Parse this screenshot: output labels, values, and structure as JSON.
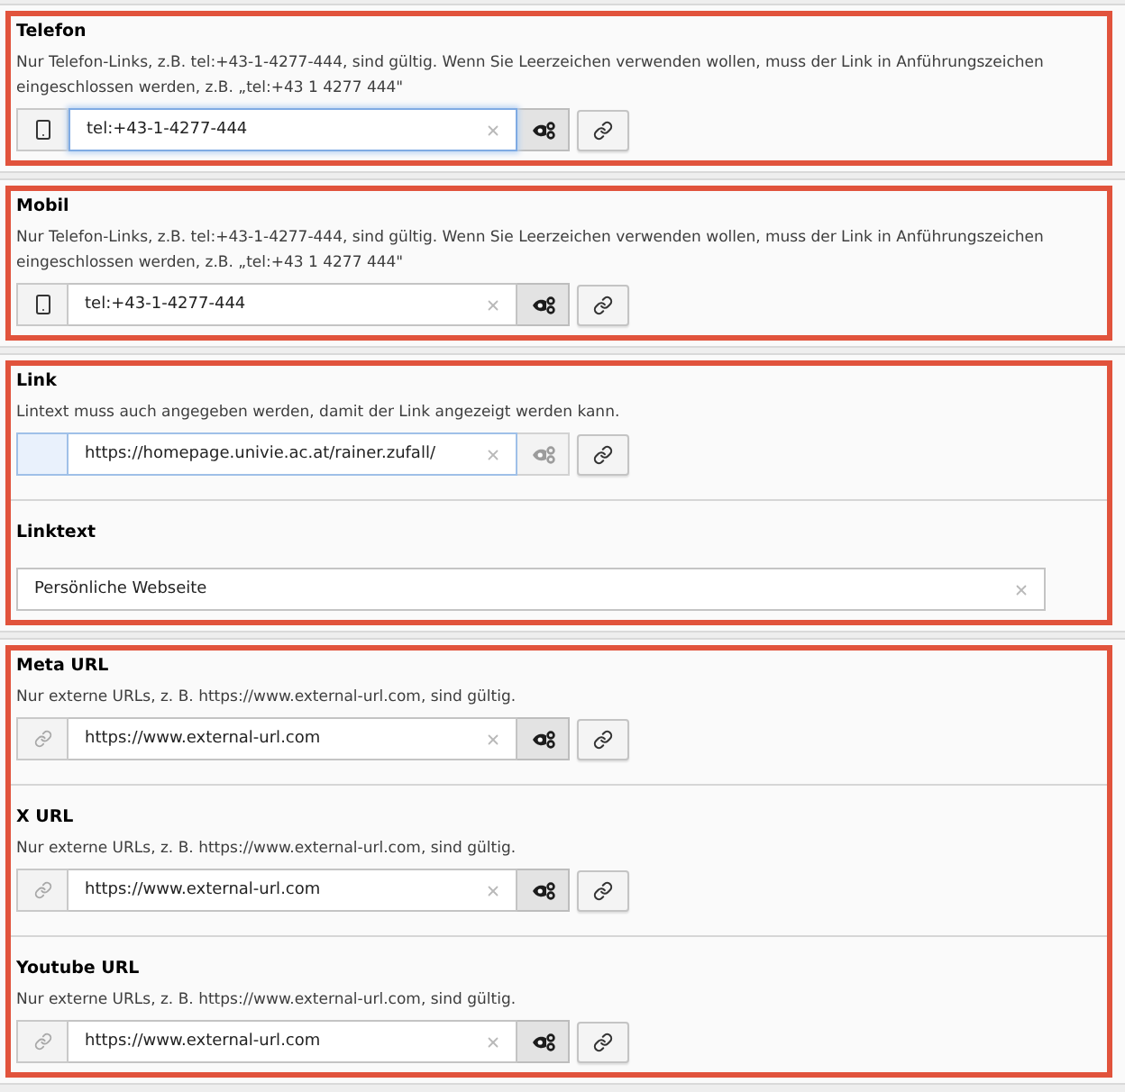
{
  "groups": [
    {
      "highlighted": true,
      "fields": [
        {
          "kind": "link",
          "title": "Telefon",
          "description": "Nur Telefon-Links, z.B. tel:+43-1-4277-444, sind gültig. Wenn Sie Leerzeichen verwenden wollen, muss der Link in Anführungszeichen eingeschlossen werden, z.B. „tel:+43 1 4277 444\"",
          "addon": {
            "kind": "phone"
          },
          "value": "tel:+43-1-4277-444",
          "focused": true,
          "hovered": false,
          "toggle_active": true
        }
      ]
    },
    {
      "highlighted": true,
      "fields": [
        {
          "kind": "link",
          "title": "Mobil",
          "description": "Nur Telefon-Links, z.B. tel:+43-1-4277-444, sind gültig. Wenn Sie Leerzeichen verwenden wollen, muss der Link in Anführungszeichen eingeschlossen werden, z.B. „tel:+43 1 4277 444\"",
          "addon": {
            "kind": "phone"
          },
          "value": "tel:+43-1-4277-444",
          "focused": false,
          "hovered": false,
          "toggle_active": true
        }
      ]
    },
    {
      "highlighted": true,
      "fields": [
        {
          "kind": "link",
          "title": "Link",
          "description": "Lintext muss auch angegeben werden, damit der Link angezeigt werden kann.",
          "addon": {
            "kind": "blank"
          },
          "value": "https://homepage.univie.ac.at/rainer.zufall/",
          "focused": false,
          "hovered": true,
          "toggle_active": false
        },
        {
          "kind": "text",
          "title": "Linktext",
          "value": "Persönliche Webseite"
        }
      ]
    },
    {
      "highlighted": true,
      "fields": [
        {
          "kind": "link",
          "title": "Meta URL",
          "description": "Nur externe URLs, z. B. https://www.external-url.com, sind gültig.",
          "addon": {
            "kind": "link"
          },
          "value": "https://www.external-url.com",
          "focused": false,
          "hovered": false,
          "toggle_active": true
        },
        {
          "kind": "link",
          "title": "X URL",
          "description": "Nur externe URLs, z. B. https://www.external-url.com, sind gültig.",
          "addon": {
            "kind": "link"
          },
          "value": "https://www.external-url.com",
          "focused": false,
          "hovered": false,
          "toggle_active": true
        },
        {
          "kind": "link",
          "title": "Youtube URL",
          "description": "Nur externe URLs, z. B. https://www.external-url.com, sind gültig.",
          "addon": {
            "kind": "link"
          },
          "value": "https://www.external-url.com",
          "focused": false,
          "hovered": false,
          "toggle_active": true
        }
      ]
    }
  ]
}
